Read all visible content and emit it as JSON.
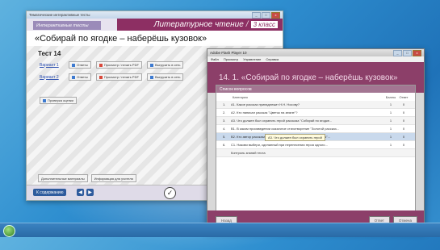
{
  "left_window": {
    "title": "Тематические интерактивные тесты",
    "tab_label": "Интерактивные тесты",
    "subject": "Литературное чтение",
    "grade": "3 класс",
    "story_title": "«Собирай по ягодке – наберёшь кузовок»",
    "test_label": "Тест 14",
    "variants": [
      {
        "label": "Вариант 1",
        "buttons": [
          "Ответы",
          "Просмотр / печать PDF",
          "Выгрузить в сеть"
        ]
      },
      {
        "label": "Вариант 2",
        "buttons": [
          "Ответы",
          "Просмотр / печать PDF",
          "Выгрузить в сеть"
        ]
      }
    ],
    "review_button": "Проверка оценки",
    "bottom_buttons": [
      "Дополнительные материалы",
      "Информация для учителя"
    ],
    "contents_button": "К содержанию",
    "nav_prev": "◀",
    "nav_next": "▶",
    "window_controls": [
      "_",
      "□",
      "x"
    ]
  },
  "right_window": {
    "title": "Adobe Flash Player 10",
    "menu": [
      "Файл",
      "Просмотр",
      "Управление",
      "Справка"
    ],
    "banner": "14. 1. «Собирай по ягодке – наберёшь кузовок»",
    "dialog_title": "Список вопросов",
    "columns": [
      "Категория",
      "Баллы",
      "Ответ"
    ],
    "questions": [
      {
        "n": "1.",
        "text": "А1. Какое рассказ принадлежит Н.Н. Носову?",
        "points": "1",
        "answer": "0"
      },
      {
        "n": "2.",
        "text": "А2. Кто написал рассказ \"Цветок на земле\"?",
        "points": "1",
        "answer": "0"
      },
      {
        "n": "3.",
        "text": "А3. Что должен был охранять герой рассказа \"Собирай по ягодке...",
        "points": "1",
        "answer": "0"
      },
      {
        "n": "4.",
        "text": "В1. В каком произведении сказочное стихотворение \"Золотой рассказ...",
        "points": "1",
        "answer": "0"
      },
      {
        "n": "5.",
        "text": "В2. Кто автор рассказа \"Собирай по ягодке – наберёшь кузовок\"...",
        "points": "1",
        "answer": "0"
      },
      {
        "n": "6.",
        "text": "С1. Назови выбери, сделанный при перенесении героя одного...",
        "points": "1",
        "answer": "0"
      },
      {
        "n": "",
        "text": "Контроль знаний теста",
        "points": "",
        "answer": ""
      }
    ],
    "tooltip": "А3. Что должен был охранять герой",
    "footer_left": "Назад",
    "footer_right": [
      "Ответ",
      "Отмена"
    ],
    "window_controls": [
      "_",
      "□",
      "x"
    ]
  }
}
